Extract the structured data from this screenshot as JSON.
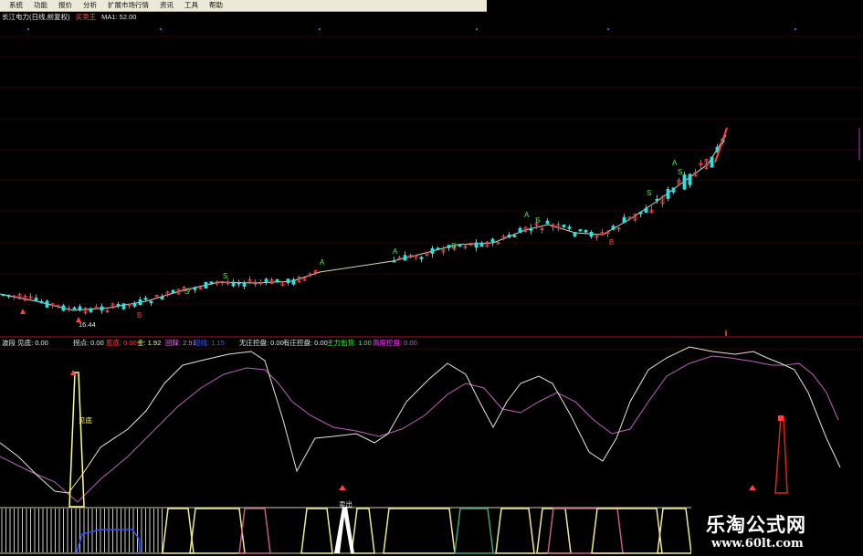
{
  "menu": {
    "items": [
      "系统",
      "功能",
      "报价",
      "分析",
      "扩展市场行情",
      "资讯",
      "工具",
      "帮助"
    ]
  },
  "stock_title": "长江电力(日线,前复权)",
  "buy_sell_marker": "买卖王",
  "ma_label": "MA1: 52.00",
  "price_low_label": "16.44",
  "indicators": {
    "i0": "波段 见底: 0.00",
    "i1": "拐点: 0.00",
    "i2": "底底: 0.00",
    "i3": "金: 1.92",
    "i4": "回踩: 2.91",
    "i5": "短线: 1.15",
    "i6": "无庄控盘: 0.00",
    "i7": "有庄控盘: 0.00",
    "i8": "主力出货: 1.00",
    "i9": "高度控盘: 0.00"
  },
  "chart_labels": {
    "jiandi": "见底",
    "maichu": "卖出"
  },
  "signals": {
    "sell": "S",
    "buy": "B",
    "pre": "A"
  },
  "watermark": {
    "cn": "乐淘公式网",
    "url": "www.60lt.com"
  },
  "colors": {
    "bg": "#000000",
    "up": "#ff4040",
    "down": "#30e0e0",
    "signal_green": "#40ff40",
    "fast_line": "#e8e6d0",
    "slow_line": "#c060c0",
    "spike": "#ffff80",
    "divider": "#a01828"
  }
}
